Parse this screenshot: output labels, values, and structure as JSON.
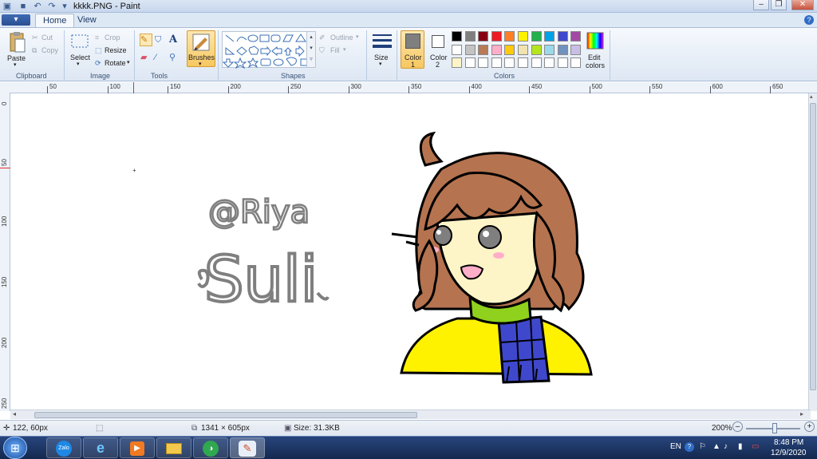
{
  "window": {
    "title": "kkkk.PNG - Paint",
    "app_menu_label": "▾"
  },
  "tabs": [
    {
      "label": "Home"
    },
    {
      "label": "View"
    }
  ],
  "clipboard": {
    "paste": "Paste",
    "cut": "Cut",
    "copy": "Copy",
    "group": "Clipboard"
  },
  "image": {
    "select": "Select",
    "crop": "Crop",
    "resize": "Resize",
    "rotate": "Rotate",
    "group": "Image"
  },
  "tools": {
    "group": "Tools",
    "brushes": "Brushes"
  },
  "shapes": {
    "outline": "Outline",
    "fill": "Fill",
    "group": "Shapes"
  },
  "size_label": "Size",
  "colors": {
    "color1_label": "Color",
    "color1_num": "1",
    "color2_label": "Color",
    "color2_num": "2",
    "edit_label_1": "Edit",
    "edit_label_2": "colors",
    "group": "Colors",
    "color1_value": "#7f7f7f",
    "color2_value": "#ffffff",
    "palette_row1": [
      "#000000",
      "#7f7f7f",
      "#880015",
      "#ed1c24",
      "#ff7f27",
      "#fff200",
      "#22b14c",
      "#00a2e8",
      "#3f48cc",
      "#a349a4"
    ],
    "palette_row2": [
      "#ffffff",
      "#c3c3c3",
      "#b97a57",
      "#ffaec9",
      "#ffc90e",
      "#efe4b0",
      "#b5e61d",
      "#99d9ea",
      "#7092be",
      "#c8bfe7"
    ],
    "palette_row3": [
      "#fdf5c8",
      "#ffffff",
      "#ffffff",
      "#ffffff",
      "#ffffff",
      "#ffffff",
      "#ffffff",
      "#ffffff",
      "#ffffff",
      "#ffffff"
    ]
  },
  "ruler": {
    "h_ticks": [
      "50",
      "100",
      "150",
      "200",
      "250",
      "300",
      "350",
      "400",
      "450",
      "500",
      "550",
      "600",
      "650"
    ],
    "v_ticks": [
      "0",
      "50",
      "100",
      "150",
      "200",
      "250"
    ]
  },
  "drawing": {
    "text_line1": "@Riya",
    "text_line2": "Suli",
    "hair_color": "#b5734f",
    "skin_color": "#fdf5c8",
    "scarf_color": "#8fd11c",
    "coat_color": "#fff200",
    "tie_color": "#3f48cc"
  },
  "status": {
    "cursor_pos": "122, 60px",
    "dimensions": "1341 × 605px",
    "size": "Size: 31.3KB",
    "zoom": "200%"
  },
  "taskbar": {
    "lang": "EN",
    "time": "8:48 PM",
    "date": "12/9/2020",
    "zalo_label": "Zalo"
  }
}
